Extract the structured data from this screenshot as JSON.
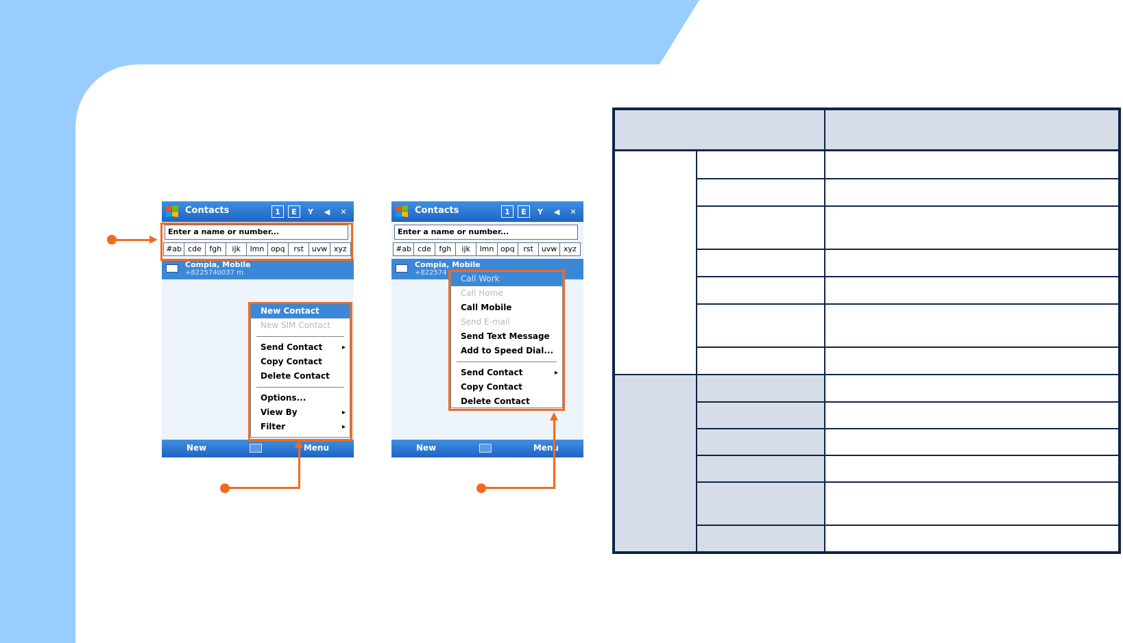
{
  "colors": {
    "accent": "#f26b1d",
    "bg_blue": "#99ccff",
    "table_border": "#0d2447",
    "table_shade": "#d6dde8",
    "selection": "#3c88d8"
  },
  "phone_left": {
    "title": "Contacts",
    "status_icons": [
      "1",
      "E",
      "Y",
      "◀",
      "✕"
    ],
    "search_placeholder": "Enter a name or number...",
    "letters": [
      "#ab",
      "cde",
      "fgh",
      "ijk",
      "lmn",
      "opq",
      "rst",
      "uvw",
      "xyz"
    ],
    "contact_name": "Compia, Mobile",
    "contact_number": "+8225740037   m",
    "menu": [
      {
        "label": "New Contact",
        "state": "selected"
      },
      {
        "label": "New SIM Contact",
        "state": "disabled"
      },
      {
        "label": "Send Contact",
        "state": "normal",
        "submenu": true
      },
      {
        "label": "Copy Contact",
        "state": "normal"
      },
      {
        "label": "Delete Contact",
        "state": "normal"
      },
      {
        "label": "Options...",
        "state": "normal"
      },
      {
        "label": "View By",
        "state": "normal",
        "submenu": true
      },
      {
        "label": "Filter",
        "state": "normal",
        "submenu": true
      }
    ],
    "menubar_left": "New",
    "menubar_right": "Menu"
  },
  "phone_right": {
    "title": "Contacts",
    "status_icons": [
      "1",
      "E",
      "Y",
      "◀",
      "✕"
    ],
    "search_placeholder": "Enter a name or number...",
    "letters": [
      "#ab",
      "cde",
      "fgh",
      "ijk",
      "lmn",
      "opq",
      "rst",
      "uvw",
      "xyz"
    ],
    "contact_name": "Compia, Mobile",
    "contact_number": "+822574",
    "menu": [
      {
        "label": "Call Work",
        "state": "selected-disabled"
      },
      {
        "label": "Call Home",
        "state": "disabled"
      },
      {
        "label": "Call Mobile",
        "state": "normal"
      },
      {
        "label": "Send E-mail",
        "state": "disabled"
      },
      {
        "label": "Send Text Message",
        "state": "normal"
      },
      {
        "label": "Add to Speed Dial...",
        "state": "normal"
      },
      {
        "label": "Send Contact",
        "state": "normal",
        "submenu": true
      },
      {
        "label": "Copy Contact",
        "state": "normal"
      },
      {
        "label": "Delete Contact",
        "state": "normal"
      }
    ],
    "menubar_left": "New",
    "menubar_right": "Menu"
  }
}
